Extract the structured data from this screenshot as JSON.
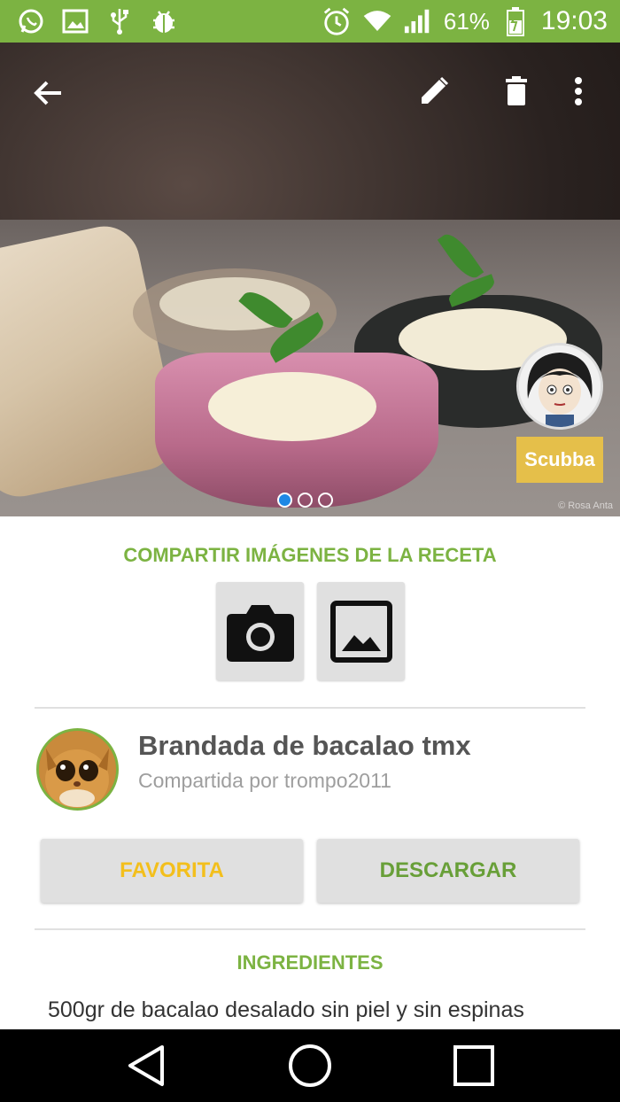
{
  "status_bar": {
    "battery": "61%",
    "time": "19:03"
  },
  "hero": {
    "watermark": "© Rosa Anta",
    "author_name": "Scubba",
    "page_count": 3,
    "active_page": 1
  },
  "share": {
    "title": "COMPARTIR IMÁGENES DE LA RECETA"
  },
  "recipe": {
    "title": "Brandada de bacalao tmx",
    "shared_by": "Compartida por trompo2011"
  },
  "actions": {
    "favorite_label": "FAVORITA",
    "download_label": "DESCARGAR"
  },
  "ingredients": {
    "title": "INGREDIENTES",
    "items": [
      "500gr de bacalao desalado sin piel y sin espinas"
    ]
  },
  "colors": {
    "accent_green": "#7cb342",
    "favorite_yellow": "#f3bf1c",
    "download_green": "#689f38",
    "badge": "#e5bf4a"
  }
}
